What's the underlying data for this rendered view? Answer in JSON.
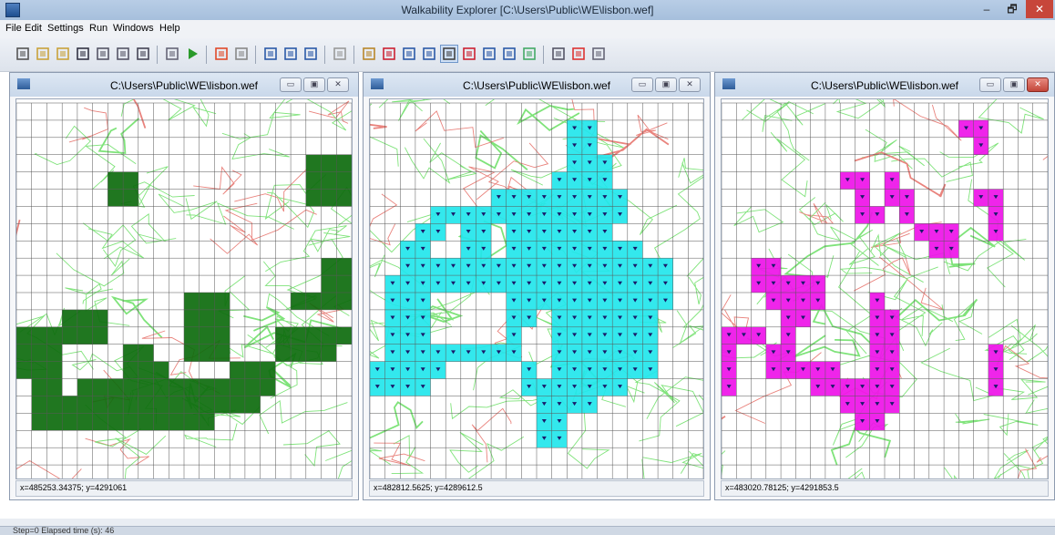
{
  "app": {
    "title": "Walkability Explorer [C:\\Users\\Public\\WE\\lisbon.wef]",
    "controls": {
      "minimize": "–",
      "restore": "🗗",
      "close": "✕"
    }
  },
  "menu": [
    {
      "label": "File"
    },
    {
      "label": "Edit"
    },
    {
      "label": "Settings"
    },
    {
      "label": "Run"
    },
    {
      "label": "Windows"
    },
    {
      "label": "Help"
    }
  ],
  "toolbar_icons": [
    "open-project-icon",
    "new-icon",
    "open-folder-icon",
    "save-icon",
    "layer-icon",
    "layer-2-icon",
    "grid-icon",
    "map-icon",
    "run-icon",
    "colors-icon",
    "undo-icon",
    "cascade-icon",
    "tile-horizontal-icon",
    "tile-vertical-icon",
    "eraser-icon",
    "select-rect-icon",
    "clear-selection-icon",
    "zoom-in-icon",
    "zoom-out-icon",
    "pan-hand-icon",
    "pointer-icon",
    "select-region-icon",
    "deselect-region-icon",
    "calculator-icon",
    "statistics-icon",
    "legend-icon",
    "settings-brush-icon"
  ],
  "windows": [
    {
      "title": "C:\\Users\\Public\\WE\\lisbon.wef",
      "status": "x=485253.34375; y=4291061",
      "fill": "#0d6b0d",
      "pattern": "green"
    },
    {
      "title": "C:\\Users\\Public\\WE\\lisbon.wef",
      "status": "x=482812.5625; y=4289612.5",
      "fill": "#22e6ec",
      "pattern": "cyan"
    },
    {
      "title": "C:\\Users\\Public\\WE\\lisbon.wef",
      "status": "x=483020.78125; y=4291853.5",
      "fill": "#ee12e8",
      "pattern": "magenta"
    }
  ],
  "grid_cells": {
    "green": [
      [
        6,
        4
      ],
      [
        7,
        4
      ],
      [
        6,
        5
      ],
      [
        7,
        5
      ],
      [
        19,
        3
      ],
      [
        20,
        3
      ],
      [
        21,
        3
      ],
      [
        19,
        4
      ],
      [
        20,
        4
      ],
      [
        21,
        4
      ],
      [
        19,
        5
      ],
      [
        20,
        5
      ],
      [
        21,
        5
      ],
      [
        20,
        9
      ],
      [
        21,
        9
      ],
      [
        20,
        10
      ],
      [
        21,
        10
      ],
      [
        18,
        11
      ],
      [
        19,
        11
      ],
      [
        20,
        11
      ],
      [
        21,
        11
      ],
      [
        3,
        12
      ],
      [
        4,
        12
      ],
      [
        5,
        12
      ],
      [
        11,
        11
      ],
      [
        12,
        11
      ],
      [
        13,
        11
      ],
      [
        11,
        12
      ],
      [
        12,
        12
      ],
      [
        13,
        12
      ],
      [
        0,
        13
      ],
      [
        1,
        13
      ],
      [
        2,
        13
      ],
      [
        3,
        13
      ],
      [
        4,
        13
      ],
      [
        5,
        13
      ],
      [
        11,
        13
      ],
      [
        12,
        13
      ],
      [
        13,
        13
      ],
      [
        17,
        13
      ],
      [
        18,
        13
      ],
      [
        19,
        13
      ],
      [
        20,
        13
      ],
      [
        21,
        13
      ],
      [
        0,
        14
      ],
      [
        1,
        14
      ],
      [
        2,
        14
      ],
      [
        7,
        14
      ],
      [
        8,
        14
      ],
      [
        11,
        14
      ],
      [
        12,
        14
      ],
      [
        13,
        14
      ],
      [
        17,
        14
      ],
      [
        18,
        14
      ],
      [
        19,
        14
      ],
      [
        20,
        14
      ],
      [
        0,
        15
      ],
      [
        1,
        15
      ],
      [
        2,
        15
      ],
      [
        7,
        15
      ],
      [
        8,
        15
      ],
      [
        9,
        15
      ],
      [
        14,
        15
      ],
      [
        15,
        15
      ],
      [
        16,
        15
      ],
      [
        1,
        16
      ],
      [
        2,
        16
      ],
      [
        4,
        16
      ],
      [
        5,
        16
      ],
      [
        6,
        16
      ],
      [
        7,
        16
      ],
      [
        8,
        16
      ],
      [
        9,
        16
      ],
      [
        10,
        16
      ],
      [
        11,
        16
      ],
      [
        12,
        16
      ],
      [
        13,
        16
      ],
      [
        14,
        16
      ],
      [
        15,
        16
      ],
      [
        16,
        16
      ],
      [
        1,
        17
      ],
      [
        2,
        17
      ],
      [
        3,
        17
      ],
      [
        4,
        17
      ],
      [
        5,
        17
      ],
      [
        6,
        17
      ],
      [
        7,
        17
      ],
      [
        8,
        17
      ],
      [
        9,
        17
      ],
      [
        10,
        17
      ],
      [
        11,
        17
      ],
      [
        12,
        17
      ],
      [
        13,
        17
      ],
      [
        14,
        17
      ],
      [
        15,
        17
      ],
      [
        1,
        18
      ],
      [
        2,
        18
      ],
      [
        3,
        18
      ],
      [
        4,
        18
      ],
      [
        5,
        18
      ],
      [
        6,
        18
      ],
      [
        7,
        18
      ],
      [
        8,
        18
      ],
      [
        9,
        18
      ],
      [
        10,
        18
      ],
      [
        11,
        18
      ],
      [
        12,
        18
      ]
    ],
    "cyan": [
      [
        13,
        1
      ],
      [
        14,
        1
      ],
      [
        13,
        2
      ],
      [
        14,
        2
      ],
      [
        13,
        3
      ],
      [
        14,
        3
      ],
      [
        15,
        3
      ],
      [
        12,
        4
      ],
      [
        13,
        4
      ],
      [
        14,
        4
      ],
      [
        15,
        4
      ],
      [
        8,
        5
      ],
      [
        9,
        5
      ],
      [
        10,
        5
      ],
      [
        11,
        5
      ],
      [
        12,
        5
      ],
      [
        13,
        5
      ],
      [
        14,
        5
      ],
      [
        15,
        5
      ],
      [
        16,
        5
      ],
      [
        4,
        6
      ],
      [
        5,
        6
      ],
      [
        6,
        6
      ],
      [
        7,
        6
      ],
      [
        8,
        6
      ],
      [
        9,
        6
      ],
      [
        10,
        6
      ],
      [
        11,
        6
      ],
      [
        12,
        6
      ],
      [
        13,
        6
      ],
      [
        14,
        6
      ],
      [
        15,
        6
      ],
      [
        16,
        6
      ],
      [
        3,
        7
      ],
      [
        4,
        7
      ],
      [
        6,
        7
      ],
      [
        7,
        7
      ],
      [
        9,
        7
      ],
      [
        10,
        7
      ],
      [
        11,
        7
      ],
      [
        12,
        7
      ],
      [
        13,
        7
      ],
      [
        14,
        7
      ],
      [
        15,
        7
      ],
      [
        2,
        8
      ],
      [
        3,
        8
      ],
      [
        6,
        8
      ],
      [
        7,
        8
      ],
      [
        9,
        8
      ],
      [
        10,
        8
      ],
      [
        11,
        8
      ],
      [
        12,
        8
      ],
      [
        13,
        8
      ],
      [
        14,
        8
      ],
      [
        15,
        8
      ],
      [
        16,
        8
      ],
      [
        17,
        8
      ],
      [
        2,
        9
      ],
      [
        3,
        9
      ],
      [
        4,
        9
      ],
      [
        5,
        9
      ],
      [
        6,
        9
      ],
      [
        7,
        9
      ],
      [
        8,
        9
      ],
      [
        9,
        9
      ],
      [
        10,
        9
      ],
      [
        11,
        9
      ],
      [
        12,
        9
      ],
      [
        13,
        9
      ],
      [
        14,
        9
      ],
      [
        15,
        9
      ],
      [
        16,
        9
      ],
      [
        17,
        9
      ],
      [
        18,
        9
      ],
      [
        19,
        9
      ],
      [
        1,
        10
      ],
      [
        2,
        10
      ],
      [
        3,
        10
      ],
      [
        4,
        10
      ],
      [
        5,
        10
      ],
      [
        6,
        10
      ],
      [
        7,
        10
      ],
      [
        8,
        10
      ],
      [
        9,
        10
      ],
      [
        10,
        10
      ],
      [
        11,
        10
      ],
      [
        12,
        10
      ],
      [
        13,
        10
      ],
      [
        14,
        10
      ],
      [
        15,
        10
      ],
      [
        16,
        10
      ],
      [
        17,
        10
      ],
      [
        18,
        10
      ],
      [
        19,
        10
      ],
      [
        1,
        11
      ],
      [
        2,
        11
      ],
      [
        3,
        11
      ],
      [
        9,
        11
      ],
      [
        10,
        11
      ],
      [
        11,
        11
      ],
      [
        12,
        11
      ],
      [
        13,
        11
      ],
      [
        14,
        11
      ],
      [
        15,
        11
      ],
      [
        16,
        11
      ],
      [
        17,
        11
      ],
      [
        18,
        11
      ],
      [
        19,
        11
      ],
      [
        1,
        12
      ],
      [
        2,
        12
      ],
      [
        3,
        12
      ],
      [
        9,
        12
      ],
      [
        10,
        12
      ],
      [
        12,
        12
      ],
      [
        13,
        12
      ],
      [
        14,
        12
      ],
      [
        15,
        12
      ],
      [
        16,
        12
      ],
      [
        17,
        12
      ],
      [
        18,
        12
      ],
      [
        1,
        13
      ],
      [
        2,
        13
      ],
      [
        3,
        13
      ],
      [
        9,
        13
      ],
      [
        12,
        13
      ],
      [
        13,
        13
      ],
      [
        14,
        13
      ],
      [
        15,
        13
      ],
      [
        16,
        13
      ],
      [
        17,
        13
      ],
      [
        18,
        13
      ],
      [
        1,
        14
      ],
      [
        2,
        14
      ],
      [
        3,
        14
      ],
      [
        4,
        14
      ],
      [
        5,
        14
      ],
      [
        6,
        14
      ],
      [
        7,
        14
      ],
      [
        8,
        14
      ],
      [
        9,
        14
      ],
      [
        12,
        14
      ],
      [
        13,
        14
      ],
      [
        14,
        14
      ],
      [
        15,
        14
      ],
      [
        16,
        14
      ],
      [
        17,
        14
      ],
      [
        18,
        14
      ],
      [
        0,
        15
      ],
      [
        1,
        15
      ],
      [
        2,
        15
      ],
      [
        3,
        15
      ],
      [
        4,
        15
      ],
      [
        10,
        15
      ],
      [
        12,
        15
      ],
      [
        13,
        15
      ],
      [
        14,
        15
      ],
      [
        15,
        15
      ],
      [
        16,
        15
      ],
      [
        17,
        15
      ],
      [
        18,
        15
      ],
      [
        0,
        16
      ],
      [
        1,
        16
      ],
      [
        2,
        16
      ],
      [
        3,
        16
      ],
      [
        10,
        16
      ],
      [
        11,
        16
      ],
      [
        12,
        16
      ],
      [
        13,
        16
      ],
      [
        14,
        16
      ],
      [
        15,
        16
      ],
      [
        16,
        16
      ],
      [
        11,
        17
      ],
      [
        12,
        17
      ],
      [
        13,
        17
      ],
      [
        14,
        17
      ],
      [
        11,
        18
      ],
      [
        12,
        18
      ],
      [
        11,
        19
      ],
      [
        12,
        19
      ]
    ],
    "magenta": [
      [
        16,
        1
      ],
      [
        17,
        1
      ],
      [
        17,
        2
      ],
      [
        8,
        4
      ],
      [
        9,
        4
      ],
      [
        11,
        4
      ],
      [
        9,
        5
      ],
      [
        11,
        5
      ],
      [
        12,
        5
      ],
      [
        17,
        5
      ],
      [
        18,
        5
      ],
      [
        9,
        6
      ],
      [
        10,
        6
      ],
      [
        12,
        6
      ],
      [
        18,
        6
      ],
      [
        13,
        7
      ],
      [
        14,
        7
      ],
      [
        15,
        7
      ],
      [
        18,
        7
      ],
      [
        14,
        8
      ],
      [
        15,
        8
      ],
      [
        2,
        9
      ],
      [
        3,
        9
      ],
      [
        2,
        10
      ],
      [
        3,
        10
      ],
      [
        4,
        10
      ],
      [
        5,
        10
      ],
      [
        6,
        10
      ],
      [
        3,
        11
      ],
      [
        4,
        11
      ],
      [
        5,
        11
      ],
      [
        6,
        11
      ],
      [
        10,
        11
      ],
      [
        4,
        12
      ],
      [
        5,
        12
      ],
      [
        10,
        12
      ],
      [
        11,
        12
      ],
      [
        0,
        13
      ],
      [
        1,
        13
      ],
      [
        2,
        13
      ],
      [
        4,
        13
      ],
      [
        10,
        13
      ],
      [
        11,
        13
      ],
      [
        0,
        14
      ],
      [
        3,
        14
      ],
      [
        4,
        14
      ],
      [
        10,
        14
      ],
      [
        11,
        14
      ],
      [
        0,
        15
      ],
      [
        3,
        15
      ],
      [
        4,
        15
      ],
      [
        5,
        15
      ],
      [
        6,
        15
      ],
      [
        7,
        15
      ],
      [
        10,
        15
      ],
      [
        11,
        15
      ],
      [
        0,
        16
      ],
      [
        6,
        16
      ],
      [
        7,
        16
      ],
      [
        8,
        16
      ],
      [
        9,
        16
      ],
      [
        10,
        16
      ],
      [
        11,
        16
      ],
      [
        8,
        17
      ],
      [
        9,
        17
      ],
      [
        10,
        17
      ],
      [
        11,
        17
      ],
      [
        9,
        18
      ],
      [
        10,
        18
      ],
      [
        18,
        14
      ],
      [
        18,
        15
      ],
      [
        18,
        16
      ]
    ]
  },
  "footer": {
    "status": "Step=0    Elapsed time (s): 46"
  }
}
